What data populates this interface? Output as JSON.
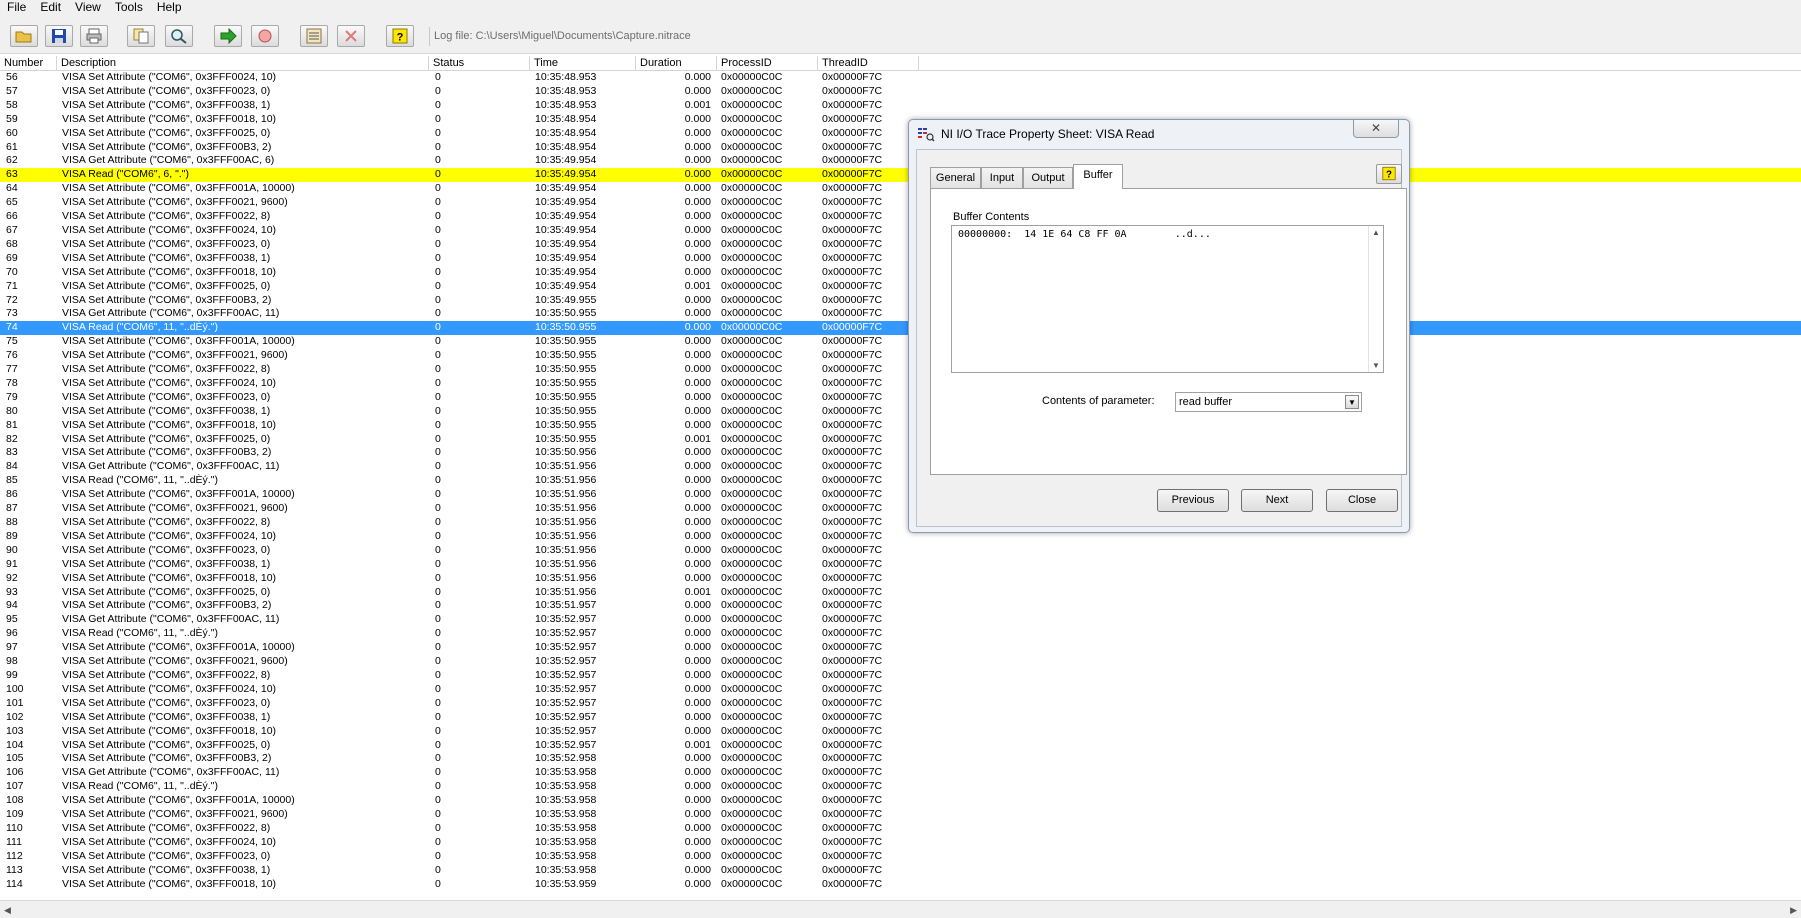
{
  "menu": [
    "File",
    "Edit",
    "View",
    "Tools",
    "Help"
  ],
  "toolbar": {
    "log_file_label": "Log file: C:\\Users\\Miguel\\Documents\\Capture.nitrace"
  },
  "columns": [
    "Number",
    "Description",
    "Status",
    "Time",
    "Duration",
    "ProcessID",
    "ThreadID"
  ],
  "rows": [
    [
      "56",
      "VISA Set Attribute (\"COM6\", 0x3FFF0024, 10)",
      "0",
      "10:35:48.953",
      "0.000",
      "0x00000C0C",
      "0x00000F7C"
    ],
    [
      "57",
      "VISA Set Attribute (\"COM6\", 0x3FFF0023, 0)",
      "0",
      "10:35:48.953",
      "0.000",
      "0x00000C0C",
      "0x00000F7C"
    ],
    [
      "58",
      "VISA Set Attribute (\"COM6\", 0x3FFF0038, 1)",
      "0",
      "10:35:48.953",
      "0.001",
      "0x00000C0C",
      "0x00000F7C"
    ],
    [
      "59",
      "VISA Set Attribute (\"COM6\", 0x3FFF0018, 10)",
      "0",
      "10:35:48.954",
      "0.000",
      "0x00000C0C",
      "0x00000F7C"
    ],
    [
      "60",
      "VISA Set Attribute (\"COM6\", 0x3FFF0025, 0)",
      "0",
      "10:35:48.954",
      "0.000",
      "0x00000C0C",
      "0x00000F7C"
    ],
    [
      "61",
      "VISA Set Attribute (\"COM6\", 0x3FFF00B3, 2)",
      "0",
      "10:35:48.954",
      "0.000",
      "0x00000C0C",
      "0x00000F7C"
    ],
    [
      "62",
      "VISA Get Attribute (\"COM6\", 0x3FFF00AC, 6)",
      "0",
      "10:35:49.954",
      "0.000",
      "0x00000C0C",
      "0x00000F7C"
    ],
    [
      "63",
      "VISA Read (\"COM6\", 6, \".\")",
      "0",
      "10:35:49.954",
      "0.000",
      "0x00000C0C",
      "0x00000F7C"
    ],
    [
      "64",
      "VISA Set Attribute (\"COM6\", 0x3FFF001A, 10000)",
      "0",
      "10:35:49.954",
      "0.000",
      "0x00000C0C",
      "0x00000F7C"
    ],
    [
      "65",
      "VISA Set Attribute (\"COM6\", 0x3FFF0021, 9600)",
      "0",
      "10:35:49.954",
      "0.000",
      "0x00000C0C",
      "0x00000F7C"
    ],
    [
      "66",
      "VISA Set Attribute (\"COM6\", 0x3FFF0022, 8)",
      "0",
      "10:35:49.954",
      "0.000",
      "0x00000C0C",
      "0x00000F7C"
    ],
    [
      "67",
      "VISA Set Attribute (\"COM6\", 0x3FFF0024, 10)",
      "0",
      "10:35:49.954",
      "0.000",
      "0x00000C0C",
      "0x00000F7C"
    ],
    [
      "68",
      "VISA Set Attribute (\"COM6\", 0x3FFF0023, 0)",
      "0",
      "10:35:49.954",
      "0.000",
      "0x00000C0C",
      "0x00000F7C"
    ],
    [
      "69",
      "VISA Set Attribute (\"COM6\", 0x3FFF0038, 1)",
      "0",
      "10:35:49.954",
      "0.000",
      "0x00000C0C",
      "0x00000F7C"
    ],
    [
      "70",
      "VISA Set Attribute (\"COM6\", 0x3FFF0018, 10)",
      "0",
      "10:35:49.954",
      "0.000",
      "0x00000C0C",
      "0x00000F7C"
    ],
    [
      "71",
      "VISA Set Attribute (\"COM6\", 0x3FFF0025, 0)",
      "0",
      "10:35:49.954",
      "0.001",
      "0x00000C0C",
      "0x00000F7C"
    ],
    [
      "72",
      "VISA Set Attribute (\"COM6\", 0x3FFF00B3, 2)",
      "0",
      "10:35:49.955",
      "0.000",
      "0x00000C0C",
      "0x00000F7C"
    ],
    [
      "73",
      "VISA Get Attribute (\"COM6\", 0x3FFF00AC, 11)",
      "0",
      "10:35:50.955",
      "0.000",
      "0x00000C0C",
      "0x00000F7C"
    ],
    [
      "74",
      "VISA Read (\"COM6\", 11, \"..dÈý.\")",
      "0",
      "10:35:50.955",
      "0.000",
      "0x00000C0C",
      "0x00000F7C"
    ],
    [
      "75",
      "VISA Set Attribute (\"COM6\", 0x3FFF001A, 10000)",
      "0",
      "10:35:50.955",
      "0.000",
      "0x00000C0C",
      "0x00000F7C"
    ],
    [
      "76",
      "VISA Set Attribute (\"COM6\", 0x3FFF0021, 9600)",
      "0",
      "10:35:50.955",
      "0.000",
      "0x00000C0C",
      "0x00000F7C"
    ],
    [
      "77",
      "VISA Set Attribute (\"COM6\", 0x3FFF0022, 8)",
      "0",
      "10:35:50.955",
      "0.000",
      "0x00000C0C",
      "0x00000F7C"
    ],
    [
      "78",
      "VISA Set Attribute (\"COM6\", 0x3FFF0024, 10)",
      "0",
      "10:35:50.955",
      "0.000",
      "0x00000C0C",
      "0x00000F7C"
    ],
    [
      "79",
      "VISA Set Attribute (\"COM6\", 0x3FFF0023, 0)",
      "0",
      "10:35:50.955",
      "0.000",
      "0x00000C0C",
      "0x00000F7C"
    ],
    [
      "80",
      "VISA Set Attribute (\"COM6\", 0x3FFF0038, 1)",
      "0",
      "10:35:50.955",
      "0.000",
      "0x00000C0C",
      "0x00000F7C"
    ],
    [
      "81",
      "VISA Set Attribute (\"COM6\", 0x3FFF0018, 10)",
      "0",
      "10:35:50.955",
      "0.000",
      "0x00000C0C",
      "0x00000F7C"
    ],
    [
      "82",
      "VISA Set Attribute (\"COM6\", 0x3FFF0025, 0)",
      "0",
      "10:35:50.955",
      "0.001",
      "0x00000C0C",
      "0x00000F7C"
    ],
    [
      "83",
      "VISA Set Attribute (\"COM6\", 0x3FFF00B3, 2)",
      "0",
      "10:35:50.956",
      "0.000",
      "0x00000C0C",
      "0x00000F7C"
    ],
    [
      "84",
      "VISA Get Attribute (\"COM6\", 0x3FFF00AC, 11)",
      "0",
      "10:35:51.956",
      "0.000",
      "0x00000C0C",
      "0x00000F7C"
    ],
    [
      "85",
      "VISA Read (\"COM6\", 11, \"..dÈý.\")",
      "0",
      "10:35:51.956",
      "0.000",
      "0x00000C0C",
      "0x00000F7C"
    ],
    [
      "86",
      "VISA Set Attribute (\"COM6\", 0x3FFF001A, 10000)",
      "0",
      "10:35:51.956",
      "0.000",
      "0x00000C0C",
      "0x00000F7C"
    ],
    [
      "87",
      "VISA Set Attribute (\"COM6\", 0x3FFF0021, 9600)",
      "0",
      "10:35:51.956",
      "0.000",
      "0x00000C0C",
      "0x00000F7C"
    ],
    [
      "88",
      "VISA Set Attribute (\"COM6\", 0x3FFF0022, 8)",
      "0",
      "10:35:51.956",
      "0.000",
      "0x00000C0C",
      "0x00000F7C"
    ],
    [
      "89",
      "VISA Set Attribute (\"COM6\", 0x3FFF0024, 10)",
      "0",
      "10:35:51.956",
      "0.000",
      "0x00000C0C",
      "0x00000F7C"
    ],
    [
      "90",
      "VISA Set Attribute (\"COM6\", 0x3FFF0023, 0)",
      "0",
      "10:35:51.956",
      "0.000",
      "0x00000C0C",
      "0x00000F7C"
    ],
    [
      "91",
      "VISA Set Attribute (\"COM6\", 0x3FFF0038, 1)",
      "0",
      "10:35:51.956",
      "0.000",
      "0x00000C0C",
      "0x00000F7C"
    ],
    [
      "92",
      "VISA Set Attribute (\"COM6\", 0x3FFF0018, 10)",
      "0",
      "10:35:51.956",
      "0.000",
      "0x00000C0C",
      "0x00000F7C"
    ],
    [
      "93",
      "VISA Set Attribute (\"COM6\", 0x3FFF0025, 0)",
      "0",
      "10:35:51.956",
      "0.001",
      "0x00000C0C",
      "0x00000F7C"
    ],
    [
      "94",
      "VISA Set Attribute (\"COM6\", 0x3FFF00B3, 2)",
      "0",
      "10:35:51.957",
      "0.000",
      "0x00000C0C",
      "0x00000F7C"
    ],
    [
      "95",
      "VISA Get Attribute (\"COM6\", 0x3FFF00AC, 11)",
      "0",
      "10:35:52.957",
      "0.000",
      "0x00000C0C",
      "0x00000F7C"
    ],
    [
      "96",
      "VISA Read (\"COM6\", 11, \"..dÈý.\")",
      "0",
      "10:35:52.957",
      "0.000",
      "0x00000C0C",
      "0x00000F7C"
    ],
    [
      "97",
      "VISA Set Attribute (\"COM6\", 0x3FFF001A, 10000)",
      "0",
      "10:35:52.957",
      "0.000",
      "0x00000C0C",
      "0x00000F7C"
    ],
    [
      "98",
      "VISA Set Attribute (\"COM6\", 0x3FFF0021, 9600)",
      "0",
      "10:35:52.957",
      "0.000",
      "0x00000C0C",
      "0x00000F7C"
    ],
    [
      "99",
      "VISA Set Attribute (\"COM6\", 0x3FFF0022, 8)",
      "0",
      "10:35:52.957",
      "0.000",
      "0x00000C0C",
      "0x00000F7C"
    ],
    [
      "100",
      "VISA Set Attribute (\"COM6\", 0x3FFF0024, 10)",
      "0",
      "10:35:52.957",
      "0.000",
      "0x00000C0C",
      "0x00000F7C"
    ],
    [
      "101",
      "VISA Set Attribute (\"COM6\", 0x3FFF0023, 0)",
      "0",
      "10:35:52.957",
      "0.000",
      "0x00000C0C",
      "0x00000F7C"
    ],
    [
      "102",
      "VISA Set Attribute (\"COM6\", 0x3FFF0038, 1)",
      "0",
      "10:35:52.957",
      "0.000",
      "0x00000C0C",
      "0x00000F7C"
    ],
    [
      "103",
      "VISA Set Attribute (\"COM6\", 0x3FFF0018, 10)",
      "0",
      "10:35:52.957",
      "0.000",
      "0x00000C0C",
      "0x00000F7C"
    ],
    [
      "104",
      "VISA Set Attribute (\"COM6\", 0x3FFF0025, 0)",
      "0",
      "10:35:52.957",
      "0.001",
      "0x00000C0C",
      "0x00000F7C"
    ],
    [
      "105",
      "VISA Set Attribute (\"COM6\", 0x3FFF00B3, 2)",
      "0",
      "10:35:52.958",
      "0.000",
      "0x00000C0C",
      "0x00000F7C"
    ],
    [
      "106",
      "VISA Get Attribute (\"COM6\", 0x3FFF00AC, 11)",
      "0",
      "10:35:53.958",
      "0.000",
      "0x00000C0C",
      "0x00000F7C"
    ],
    [
      "107",
      "VISA Read (\"COM6\", 11, \"..dÈý.\")",
      "0",
      "10:35:53.958",
      "0.000",
      "0x00000C0C",
      "0x00000F7C"
    ],
    [
      "108",
      "VISA Set Attribute (\"COM6\", 0x3FFF001A, 10000)",
      "0",
      "10:35:53.958",
      "0.000",
      "0x00000C0C",
      "0x00000F7C"
    ],
    [
      "109",
      "VISA Set Attribute (\"COM6\", 0x3FFF0021, 9600)",
      "0",
      "10:35:53.958",
      "0.000",
      "0x00000C0C",
      "0x00000F7C"
    ],
    [
      "110",
      "VISA Set Attribute (\"COM6\", 0x3FFF0022, 8)",
      "0",
      "10:35:53.958",
      "0.000",
      "0x00000C0C",
      "0x00000F7C"
    ],
    [
      "111",
      "VISA Set Attribute (\"COM6\", 0x3FFF0024, 10)",
      "0",
      "10:35:53.958",
      "0.000",
      "0x00000C0C",
      "0x00000F7C"
    ],
    [
      "112",
      "VISA Set Attribute (\"COM6\", 0x3FFF0023, 0)",
      "0",
      "10:35:53.958",
      "0.000",
      "0x00000C0C",
      "0x00000F7C"
    ],
    [
      "113",
      "VISA Set Attribute (\"COM6\", 0x3FFF0038, 1)",
      "0",
      "10:35:53.958",
      "0.000",
      "0x00000C0C",
      "0x00000F7C"
    ],
    [
      "114",
      "VISA Set Attribute (\"COM6\", 0x3FFF0018, 10)",
      "0",
      "10:35:53.959",
      "0.000",
      "0x00000C0C",
      "0x00000F7C"
    ]
  ],
  "highlighted_row": "63",
  "selected_row": "74",
  "colors": {
    "highlight": "#ffff00",
    "selection": "#3399ff"
  },
  "dialog": {
    "title": "NI I/O Trace Property Sheet: VISA Read",
    "tabs": [
      "General",
      "Input",
      "Output",
      "Buffer"
    ],
    "active_tab": "Buffer",
    "buffer_label": "Buffer Contents",
    "buffer_text": "00000000:  14 1E 64 C8 FF 0A        ..d...",
    "param_label": "Contents of parameter:",
    "param_value": "read buffer",
    "buttons": {
      "previous": "Previous",
      "next": "Next",
      "close": "Close"
    }
  }
}
